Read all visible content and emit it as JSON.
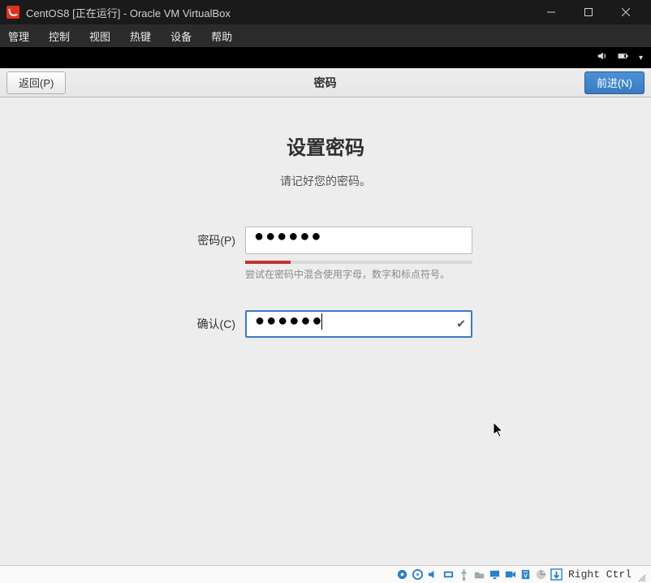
{
  "window": {
    "title": "CentOS8 [正在运行] - Oracle VM VirtualBox"
  },
  "menubar": [
    "管理",
    "控制",
    "视图",
    "热键",
    "设备",
    "帮助"
  ],
  "headerbar": {
    "back": "返回(P)",
    "title": "密码",
    "forward": "前进(N)"
  },
  "page": {
    "heading": "设置密码",
    "subtitle": "请记好您的密码。",
    "password_label": "密码(P)",
    "confirm_label": "确认(C)",
    "password_value": "●●●●●●",
    "confirm_value": "●●●●●●",
    "hint": "尝试在密码中混合使用字母，数字和标点符号。"
  },
  "statusbar": {
    "host_key": "Right Ctrl"
  },
  "icons": {
    "sound": "sound-icon",
    "battery": "battery-icon",
    "dropdown": "chevron-down-icon",
    "hdd": "hdd-icon",
    "optical": "optical-icon",
    "usb": "usb-icon",
    "net": "net-icon",
    "shared": "shared-icon",
    "display": "display-icon",
    "record": "record-icon",
    "camera": "camera-icon",
    "clipboard": "clipboard-icon",
    "mouse": "mouse-icon",
    "hostkey": "hostkey-icon"
  }
}
